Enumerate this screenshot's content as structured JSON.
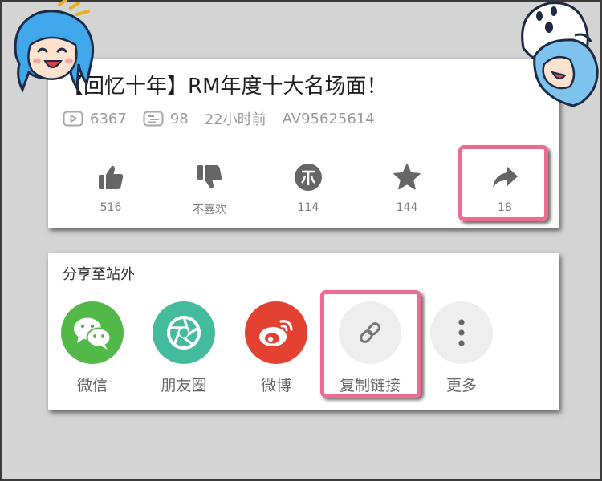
{
  "video": {
    "title": "【回忆十年】RM年度十大名场面！",
    "views": "6367",
    "danmaku": "98",
    "time": "22小时前",
    "av_id": "AV95625614"
  },
  "actions": [
    {
      "id": "like",
      "icon": "thumbs-up-icon",
      "label": "516"
    },
    {
      "id": "dislike",
      "icon": "thumbs-down-icon",
      "label": "不喜欢"
    },
    {
      "id": "coin",
      "icon": "coin-icon",
      "label": "114"
    },
    {
      "id": "favorite",
      "icon": "star-icon",
      "label": "144"
    },
    {
      "id": "share",
      "icon": "share-arrow-icon",
      "label": "18"
    }
  ],
  "share": {
    "title": "分享至站外",
    "items": [
      {
        "id": "wechat",
        "icon": "wechat-icon",
        "label": "微信",
        "color": "#52b848"
      },
      {
        "id": "moments",
        "icon": "moments-icon",
        "label": "朋友圈",
        "color": "#44bb9d"
      },
      {
        "id": "weibo",
        "icon": "weibo-icon",
        "label": "微博",
        "color": "#e34233"
      },
      {
        "id": "copy-link",
        "icon": "link-icon",
        "label": "复制链接",
        "color": "#eeeeee"
      },
      {
        "id": "more",
        "icon": "more-dots-icon",
        "label": "更多",
        "color": "#eeeeee"
      }
    ]
  },
  "colors": {
    "highlight": "#ef6b91",
    "icon_gray": "#666666",
    "background": "#d4d4d4"
  }
}
